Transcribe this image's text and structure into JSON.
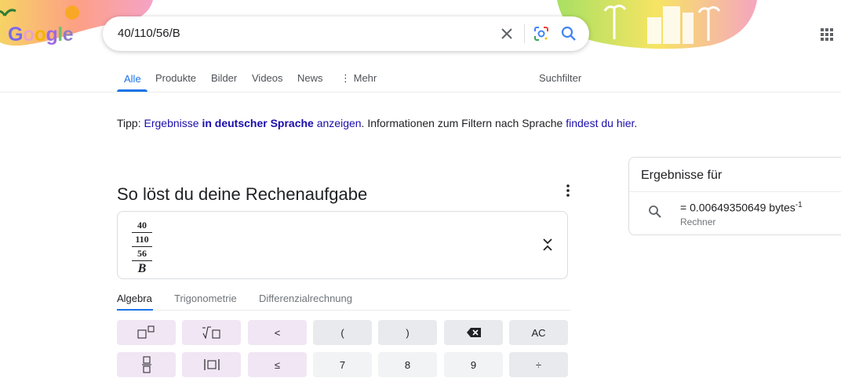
{
  "logo": {
    "letters": [
      "G",
      "o",
      "o",
      "g",
      "l",
      "e"
    ],
    "colors": [
      "#7b68ee",
      "#e8a4c8",
      "#f4b400",
      "#9c6ade",
      "#6ac46a",
      "#8e7cc3"
    ]
  },
  "search": {
    "query": "40/110/56/B"
  },
  "tabs": [
    {
      "label": "Alle",
      "active": true
    },
    {
      "label": "Produkte",
      "active": false
    },
    {
      "label": "Bilder",
      "active": false
    },
    {
      "label": "Videos",
      "active": false
    },
    {
      "label": "News",
      "active": false
    },
    {
      "label": "Mehr",
      "active": false
    }
  ],
  "suchfilter": "Suchfilter",
  "tip": {
    "prefix": "Tipp:",
    "link1": "Ergebnisse",
    "bold": "in deutscher Sprache",
    "link2": "anzeigen",
    "middle": ". Informationen zum Filtern nach Sprache",
    "link3": "findest du hier",
    "suffix": "."
  },
  "calculator": {
    "title": "So löst du deine Rechenaufgabe",
    "expression": {
      "n1": "40",
      "n2": "110",
      "n3": "56",
      "var": "B"
    },
    "tabs": [
      {
        "label": "Algebra",
        "active": true
      },
      {
        "label": "Trigonometrie",
        "active": false
      },
      {
        "label": "Differenzialrechnung",
        "active": false
      }
    ],
    "keys_row1": [
      {
        "label": "□□",
        "style": "op",
        "name": "power-key"
      },
      {
        "label": "√□",
        "style": "op",
        "name": "root-key"
      },
      {
        "label": "<",
        "style": "op",
        "name": "less-than-key"
      },
      {
        "label": "(",
        "style": "gray",
        "name": "open-paren-key"
      },
      {
        "label": ")",
        "style": "gray",
        "name": "close-paren-key"
      },
      {
        "label": "⌫",
        "style": "gray",
        "name": "backspace-key"
      },
      {
        "label": "AC",
        "style": "gray",
        "name": "clear-all-key"
      }
    ],
    "keys_row2": [
      {
        "label": "□/□",
        "style": "op",
        "name": "fraction-key"
      },
      {
        "label": "|□|",
        "style": "op",
        "name": "absolute-key"
      },
      {
        "label": "≤",
        "style": "op",
        "name": "less-equal-key"
      },
      {
        "label": "7",
        "style": "light",
        "name": "digit-7-key"
      },
      {
        "label": "8",
        "style": "light",
        "name": "digit-8-key"
      },
      {
        "label": "9",
        "style": "light",
        "name": "digit-9-key"
      },
      {
        "label": "÷",
        "style": "gray",
        "name": "divide-key"
      }
    ]
  },
  "results_panel": {
    "title": "Ergebnisse für",
    "result": "= 0.00649350649 bytes",
    "exponent": "-1",
    "source": "Rechner"
  }
}
